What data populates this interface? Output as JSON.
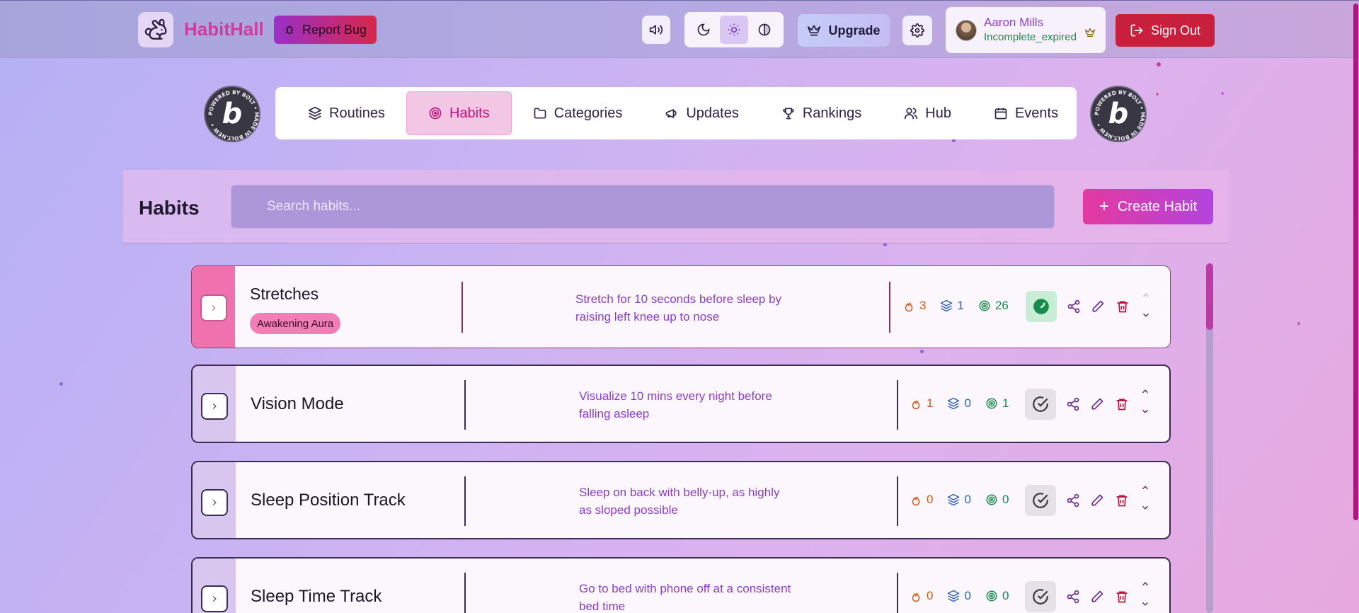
{
  "header": {
    "brand": "HabitHall",
    "report_bug_label": "Report Bug",
    "upgrade_label": "Upgrade",
    "user": {
      "name": "Aaron Mills",
      "status": "Incomplete_expired"
    },
    "sign_out_label": "Sign Out",
    "theme_modes": [
      "moon-icon",
      "sun-icon",
      "contrast-icon"
    ],
    "active_theme": "sun-icon"
  },
  "badges": {
    "bolt_ring_text": "POWERED BY BOLT • MADE IN BOLT.NEW •",
    "bolt_letter": "b"
  },
  "nav": {
    "items": [
      {
        "label": "Routines",
        "icon": "layers-icon"
      },
      {
        "label": "Habits",
        "icon": "target-icon",
        "active": true
      },
      {
        "label": "Categories",
        "icon": "folder-icon"
      },
      {
        "label": "Updates",
        "icon": "megaphone-icon"
      },
      {
        "label": "Rankings",
        "icon": "trophy-icon"
      },
      {
        "label": "Hub",
        "icon": "users-icon"
      },
      {
        "label": "Events",
        "icon": "calendar-icon"
      }
    ]
  },
  "habits_page": {
    "title": "Habits",
    "search_placeholder": "Search habits...",
    "create_label": "Create Habit"
  },
  "habits": [
    {
      "name": "Stretches",
      "tag": "Awakening Aura",
      "description": "Stretch for 10 seconds before sleep by raising left knee up to nose",
      "streak": "3",
      "routines": "1",
      "completions": "26",
      "completed_today": true
    },
    {
      "name": "Vision Mode",
      "description": "Visualize 10 mins every night before falling asleep",
      "streak": "1",
      "routines": "0",
      "completions": "1",
      "completed_today": false
    },
    {
      "name": "Sleep Position Track",
      "description": "Sleep on back with belly-up, as highly as sloped possible",
      "streak": "0",
      "routines": "0",
      "completions": "0",
      "completed_today": false
    },
    {
      "name": "Sleep Time Track",
      "description": "Go to bed with phone off at a consistent bed time",
      "streak": "0",
      "routines": "0",
      "completions": "0",
      "completed_today": false
    }
  ],
  "colors": {
    "brand": "#d23b9d",
    "accent_pink": "#e4399f",
    "signout": "#c8203c",
    "done_green": "#178a4c"
  }
}
